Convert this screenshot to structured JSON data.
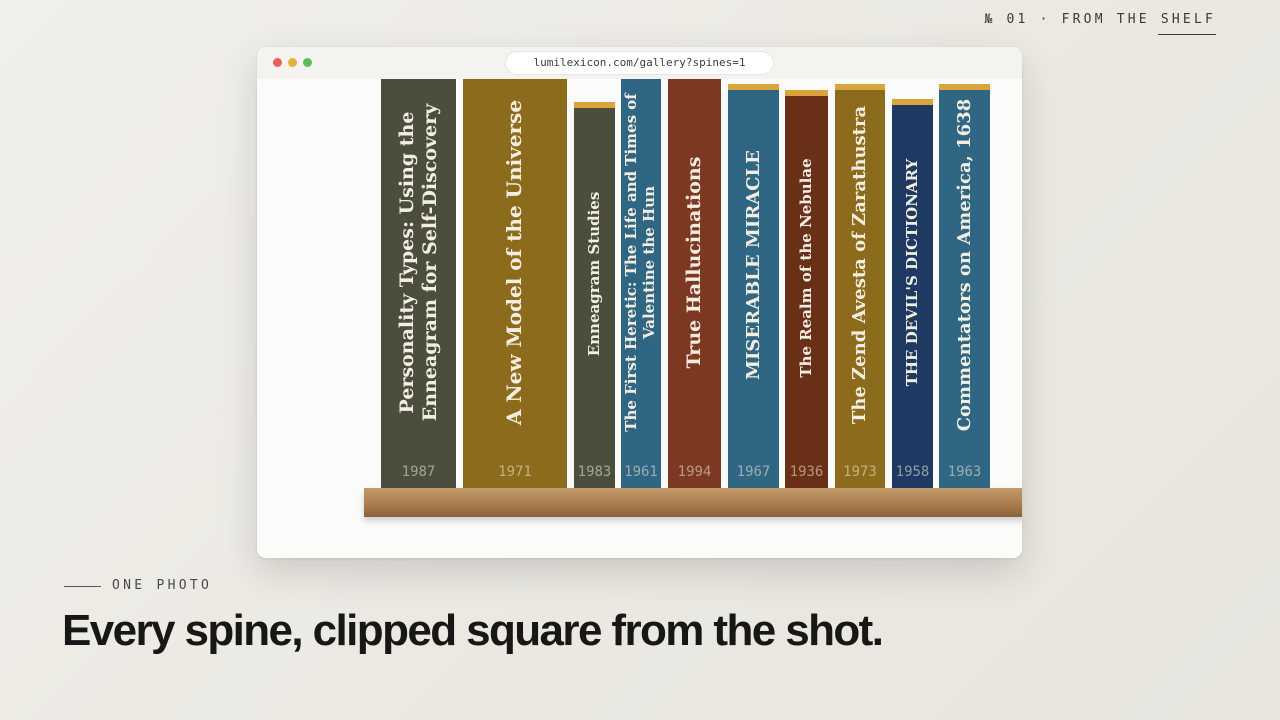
{
  "header": {
    "issue": "№ 01 · FROM THE SHELF"
  },
  "browser": {
    "url": "lumilexicon.com/gallery?spines=1"
  },
  "books": [
    {
      "title": "Personality Types: Using the Enneagram for Self-Discovery",
      "year": "1987",
      "color": "#4b4e3c"
    },
    {
      "title": "A New Model of the Universe",
      "year": "1971",
      "color": "#8d6b1c"
    },
    {
      "title": "Enneagram Studies",
      "year": "1983",
      "color": "#4b4e3c"
    },
    {
      "title": "The First Heretic: The Life and Times of Valentine the Hun",
      "year": "1961",
      "color": "#2e6683"
    },
    {
      "title": "True Hallucinations",
      "year": "1994",
      "color": "#7d3821"
    },
    {
      "title": "MISERABLE MIRACLE",
      "year": "1967",
      "color": "#2e6683"
    },
    {
      "title": "The Realm of the Nebulae",
      "year": "1936",
      "color": "#6a3017"
    },
    {
      "title": "The Zend Avesta of Zarathustra",
      "year": "1973",
      "color": "#8d6b1c"
    },
    {
      "title": "THE DEVIL'S DICTIONARY",
      "year": "1958",
      "color": "#1e3a63"
    },
    {
      "title": "Commentators on America, 1638",
      "year": "1963",
      "color": "#2e6683"
    }
  ],
  "caption": {
    "label": "ONE PHOTO",
    "headline": "Every spine, clipped square from the shot."
  }
}
